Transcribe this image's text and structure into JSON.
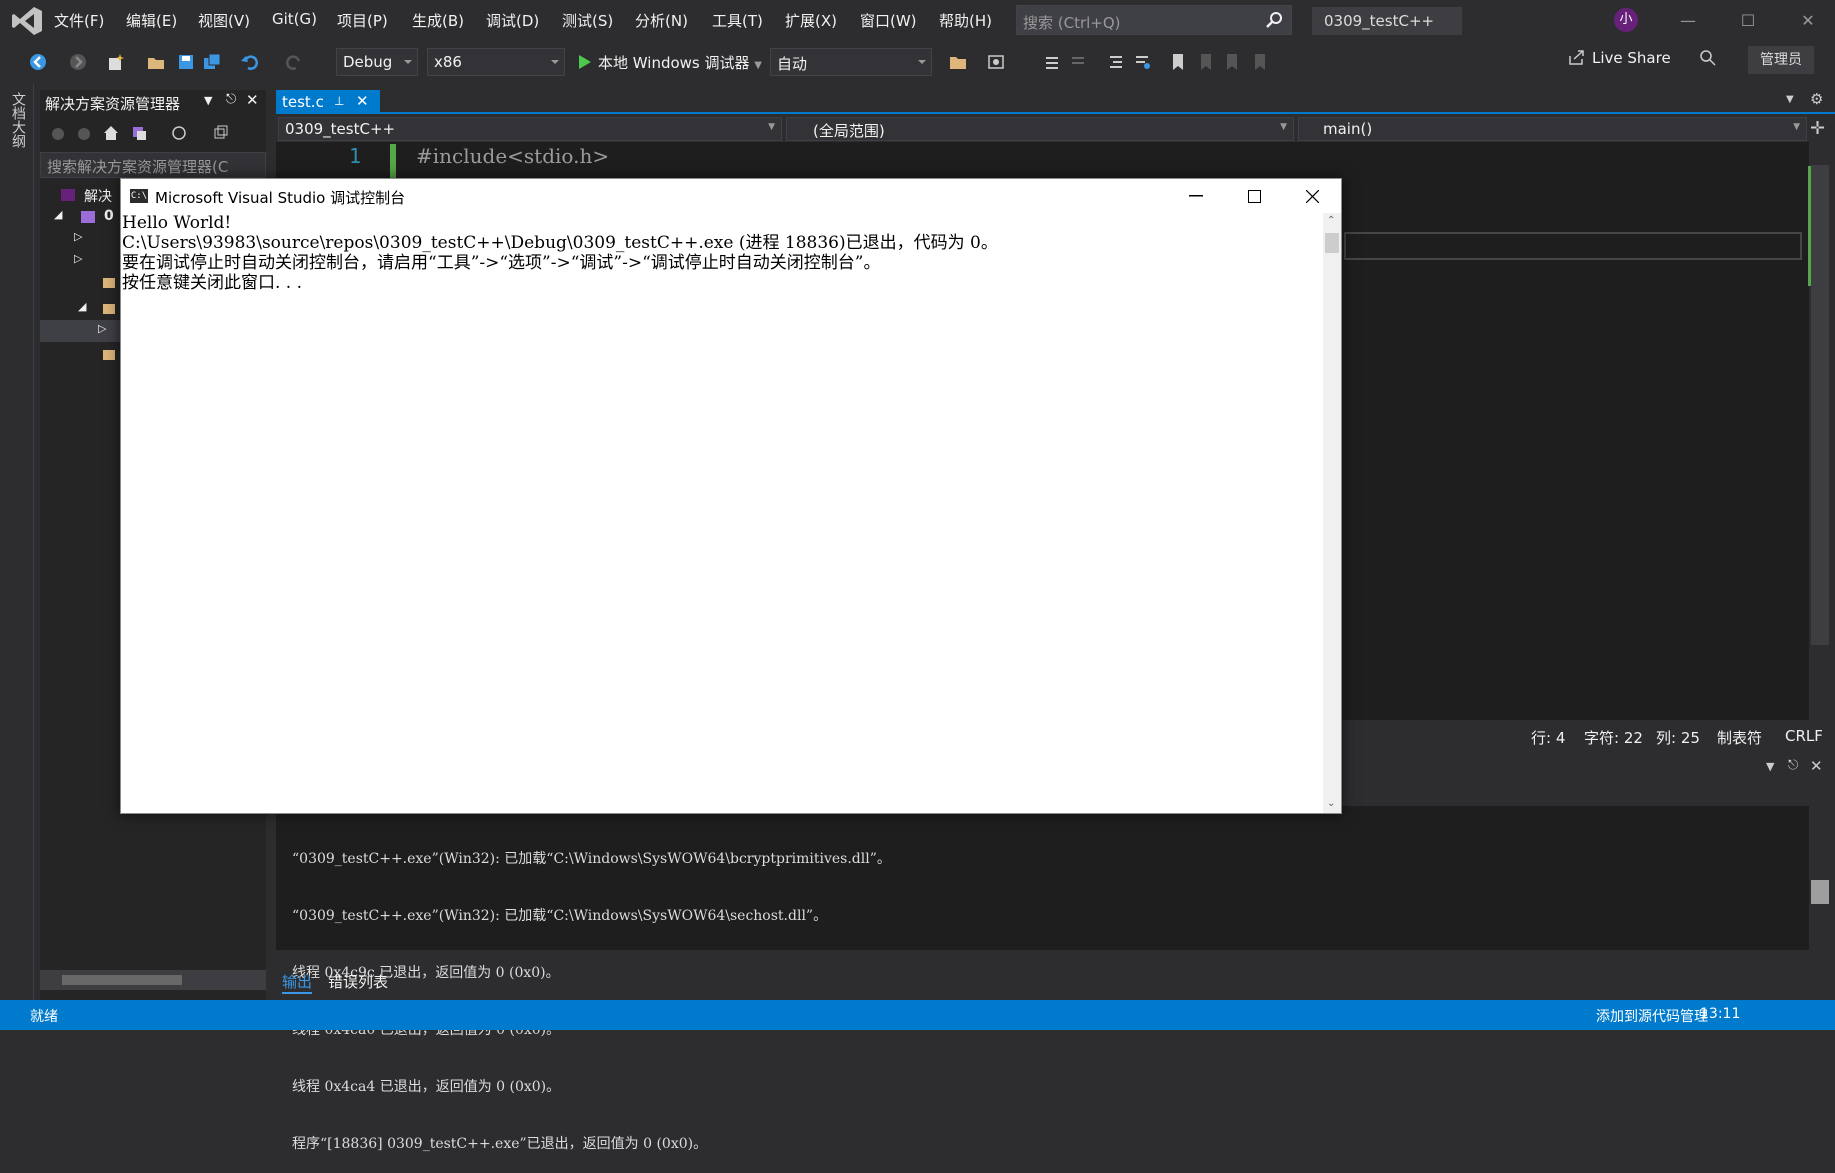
{
  "menubar": {
    "items": [
      "文件(F)",
      "编辑(E)",
      "视图(V)",
      "Git(G)",
      "项目(P)",
      "生成(B)",
      "调试(D)",
      "测试(S)",
      "分析(N)",
      "工具(T)",
      "扩展(X)",
      "窗口(W)",
      "帮助(H)"
    ],
    "search_placeholder": "搜索 (Ctrl+Q)",
    "solution_title": "0309_testC++",
    "avatar": "小"
  },
  "toolbar": {
    "config": "Debug",
    "platform": "x86",
    "run_label": "本地 Windows 调试器",
    "auto": "自动",
    "live_share": "Live Share",
    "admin": "管理员"
  },
  "left_strip": {
    "outline_tab": "文档大纲"
  },
  "solution_explorer": {
    "title": "解决方案资源管理器",
    "search_placeholder": "搜索解决方案资源管理器(C",
    "root_label": "解决",
    "project_label": "0"
  },
  "editor": {
    "tab_label": "test.c",
    "nav_project": "0309_testC++",
    "nav_scope": "(全局范围)",
    "nav_member": "main()",
    "line_number": "1",
    "code_line": "#include<stdio.h>",
    "status": {
      "line": "行: 4",
      "char": "字符: 22",
      "col": "列: 25",
      "tabs": "制表符",
      "eol": "CRLF"
    }
  },
  "output": {
    "lines": [
      "“0309_testC++.exe”(Win32): 已加载“C:\\Windows\\SysWOW64\\bcryptprimitives.dll”。",
      "“0309_testC++.exe”(Win32): 已加载“C:\\Windows\\SysWOW64\\sechost.dll”。",
      "线程 0x4c9c 已退出，返回值为 0 (0x0)。",
      "线程 0x4ca0 已退出，返回值为 0 (0x0)。",
      "线程 0x4ca4 已退出，返回值为 0 (0x0)。",
      "程序“[18836] 0309_testC++.exe”已退出，返回值为 0 (0x0)。"
    ],
    "tabs": [
      "输出",
      "错误列表"
    ]
  },
  "console": {
    "title": "Microsoft Visual Studio 调试控制台",
    "icon_text": "C:\\",
    "lines": [
      "Hello World!",
      "C:\\Users\\93983\\source\\repos\\0309_testC++\\Debug\\0309_testC++.exe (进程 18836)已退出，代码为 0。",
      "要在调试停止时自动关闭控制台，请启用“工具”->“选项”->“调试”->“调试停止时自动关闭控制台”。",
      "按任意键关闭此窗口. . ."
    ]
  },
  "statusbar": {
    "left": "就绪",
    "right": "添加到源代码管理",
    "clock": "13:11"
  },
  "colors": {
    "accent": "#007acc",
    "bg": "#2d2d30",
    "editor_bg": "#1e1e1e",
    "vs_purple": "#68217a"
  }
}
